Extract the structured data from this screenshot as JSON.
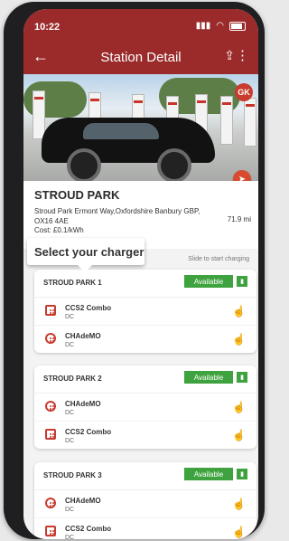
{
  "status": {
    "time": "10:22",
    "signal": "▮▮▮",
    "wifi": "◠"
  },
  "header": {
    "title": "Station Detail",
    "back": "←",
    "share": "⇪",
    "more": "⋮"
  },
  "photo": {
    "badge": "GK"
  },
  "station": {
    "name": "STROUD PARK",
    "address": "Stroud Park Ermont Way,Oxfordshire Banbury GBP, OX16 4AE",
    "cost": "Cost: £0.1/kWh",
    "distance": "71.9 mi"
  },
  "overlay": {
    "select_charger": "Select your charger",
    "slide_hint": "Slide to start charging"
  },
  "chargers": [
    {
      "title": "STROUD PARK 1",
      "status": "Available",
      "connectors": [
        {
          "name": "CCS2 Combo",
          "type": "DC"
        },
        {
          "name": "CHAdeMO",
          "type": "DC"
        }
      ]
    },
    {
      "title": "STROUD PARK 2",
      "status": "Available",
      "connectors": [
        {
          "name": "CHAdeMO",
          "type": "DC"
        },
        {
          "name": "CCS2 Combo",
          "type": "DC"
        }
      ]
    },
    {
      "title": "STROUD PARK 3",
      "status": "Available",
      "connectors": [
        {
          "name": "CHAdeMO",
          "type": "DC"
        },
        {
          "name": "CCS2 Combo",
          "type": "DC"
        }
      ]
    }
  ],
  "colors": {
    "brand": "#9b2b2b",
    "available": "#3ea33e",
    "accent": "#c83b2e"
  }
}
